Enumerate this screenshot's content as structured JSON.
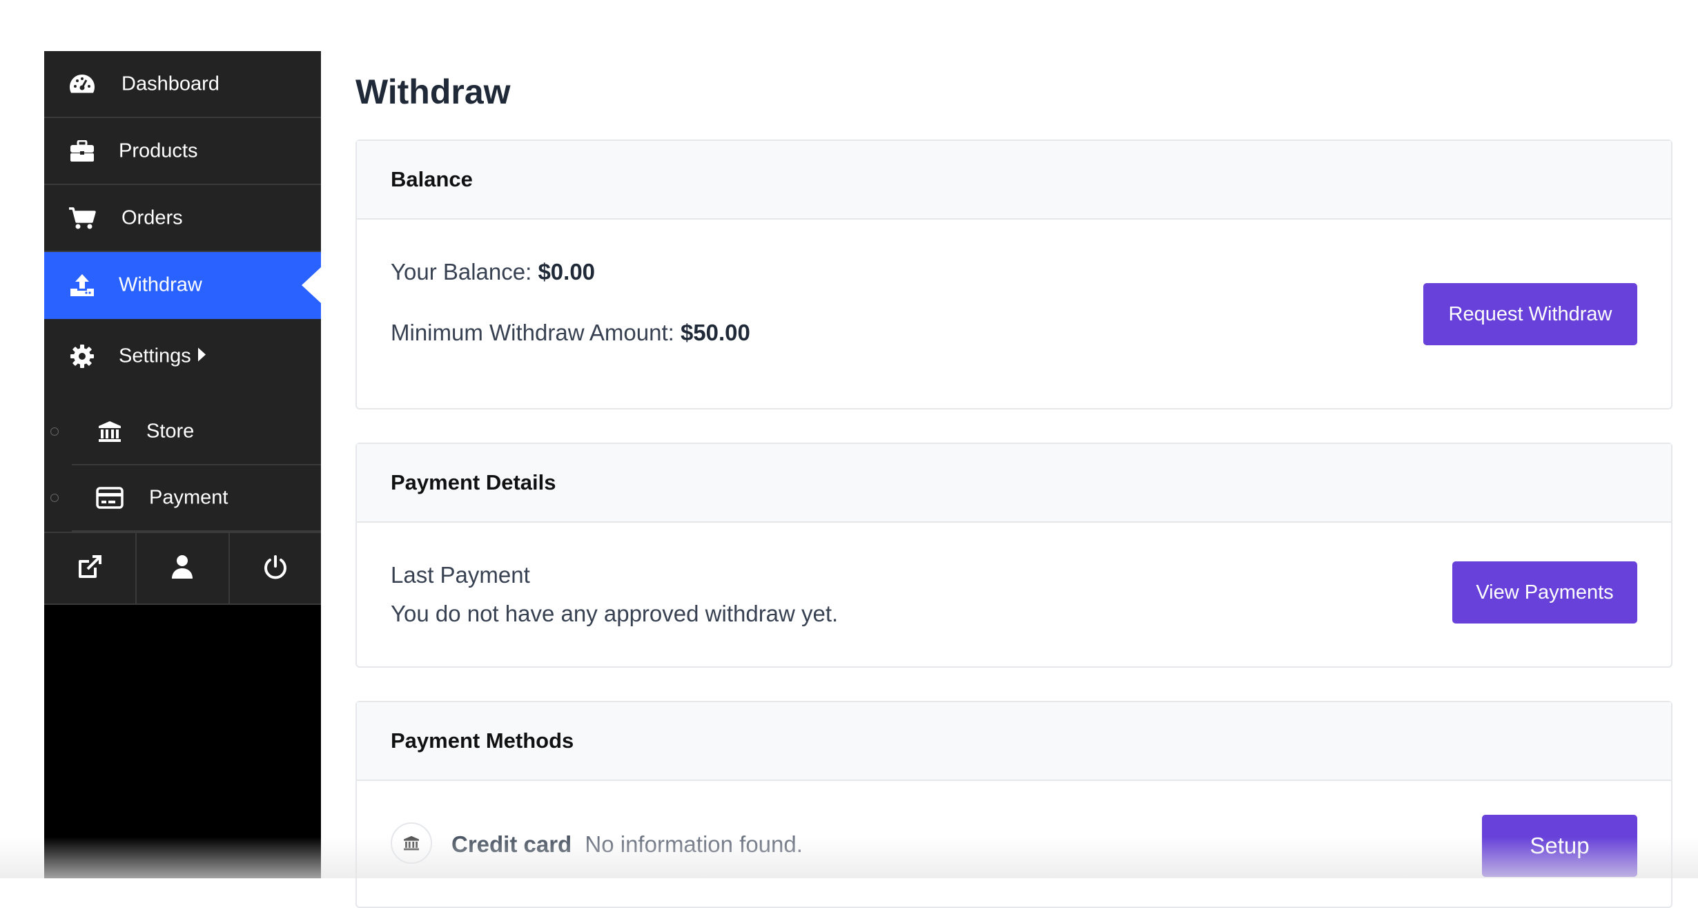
{
  "sidebar": {
    "items": [
      {
        "label": "Dashboard",
        "icon": "dashboard-gauge-icon"
      },
      {
        "label": "Products",
        "icon": "briefcase-icon"
      },
      {
        "label": "Orders",
        "icon": "shopping-cart-icon"
      },
      {
        "label": "Withdraw",
        "icon": "upload-icon",
        "active": true
      },
      {
        "label": "Settings",
        "icon": "gear-icon"
      }
    ],
    "sub_items": [
      {
        "label": "Store",
        "icon": "bank-icon"
      },
      {
        "label": "Payment",
        "icon": "credit-card-icon"
      }
    ],
    "bottom_icons": [
      "external-link-icon",
      "user-icon",
      "power-icon"
    ],
    "active_color": "#2962ff"
  },
  "page": {
    "title": "Withdraw"
  },
  "balance": {
    "header": "Balance",
    "balance_label": "Your Balance:",
    "balance_value": "$0.00",
    "min_label": "Minimum Withdraw Amount:",
    "min_value": "$50.00",
    "button": "Request Withdraw"
  },
  "payment_details": {
    "header": "Payment Details",
    "last_payment_label": "Last Payment",
    "last_payment_text": "You do not have any approved withdraw yet.",
    "button": "View Payments"
  },
  "payment_methods": {
    "header": "Payment Methods",
    "method_name": "Credit card",
    "method_status": "No information found.",
    "button": "Setup",
    "icon": "bank-icon"
  },
  "colors": {
    "button": "#6741d9",
    "sidebar_bg": "#232323"
  }
}
